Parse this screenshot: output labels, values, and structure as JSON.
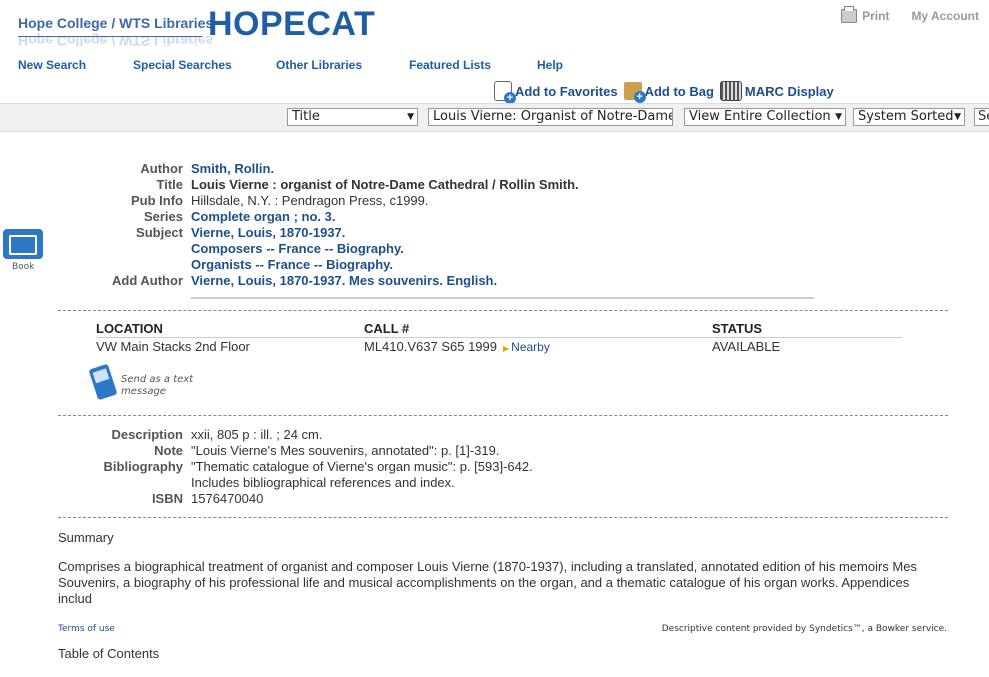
{
  "header": {
    "college": "Hope College / WTS Libraries",
    "logo": "HOPECAT",
    "print_label": "Print",
    "account_label": "My Account"
  },
  "nav": [
    "New Search",
    "Special Searches",
    "Other Libraries",
    "Featured Lists",
    "Help"
  ],
  "tools": {
    "favorites": "Add to Favorites",
    "bag": "Add to Bag",
    "marc": "MARC Display"
  },
  "search": {
    "type": "Title",
    "query": "Louis Vierne: Organist of Notre-Dame Cathedral",
    "scope": "View Entire Collection",
    "sort": "System Sorted",
    "go": "Search"
  },
  "format": {
    "label": "Book",
    "icon": "book-icon"
  },
  "record": {
    "author_label": "Author",
    "author": "Smith, Rollin.",
    "title_label": "Title",
    "title": "Louis Vierne : organist of Notre-Dame Cathedral / Rollin Smith.",
    "pubinfo_label": "Pub Info",
    "pubinfo": "Hillsdale, N.Y. : Pendragon Press, c1999.",
    "series_label": "Series",
    "series": "Complete organ ; no. 3.",
    "subject_label": "Subject",
    "subjects": [
      "Vierne, Louis, 1870-1937.",
      "Composers -- France -- Biography.",
      "Organists -- France -- Biography."
    ],
    "addauthor_label": "Add Author",
    "addauthor": "Vierne, Louis, 1870-1937. Mes souvenirs. English."
  },
  "holdings": {
    "headers": [
      "LOCATION",
      "CALL #",
      "STATUS"
    ],
    "rows": [
      {
        "location": "VW Main Stacks 2nd Floor",
        "call": "ML410.V637 S65 1999",
        "nearby": "Nearby",
        "status": "AVAILABLE"
      }
    ]
  },
  "sms": {
    "line1": "Send as a text",
    "line2": "message"
  },
  "details": {
    "description_label": "Description",
    "description": "xxii, 805 p : ill. ; 24 cm.",
    "note_label": "Note",
    "note": "\"Louis Vierne's Mes souvenirs, annotated\": p. [1]-319.",
    "bibliography_label": "Bibliography",
    "bibliography": [
      "\"Thematic catalogue of Vierne's organ music\": p. [593]-642.",
      "Includes bibliographical references and index."
    ],
    "isbn_label": "ISBN",
    "isbn": "1576470040"
  },
  "summary": {
    "heading": "Summary",
    "text": "Comprises a biographical treatment of organist and composer Louis Vierne (1870-1937), including a translated, annotated edition of his memoirs Mes Souvenirs, a biography of his professional life and musical accomplishments on the organ, and a thematic catalogue of his organ works. Appendices includ",
    "terms": "Terms of use",
    "credit": "Descriptive content provided by Syndetics™, a Bowker service."
  },
  "toc_heading": "Table of Contents"
}
